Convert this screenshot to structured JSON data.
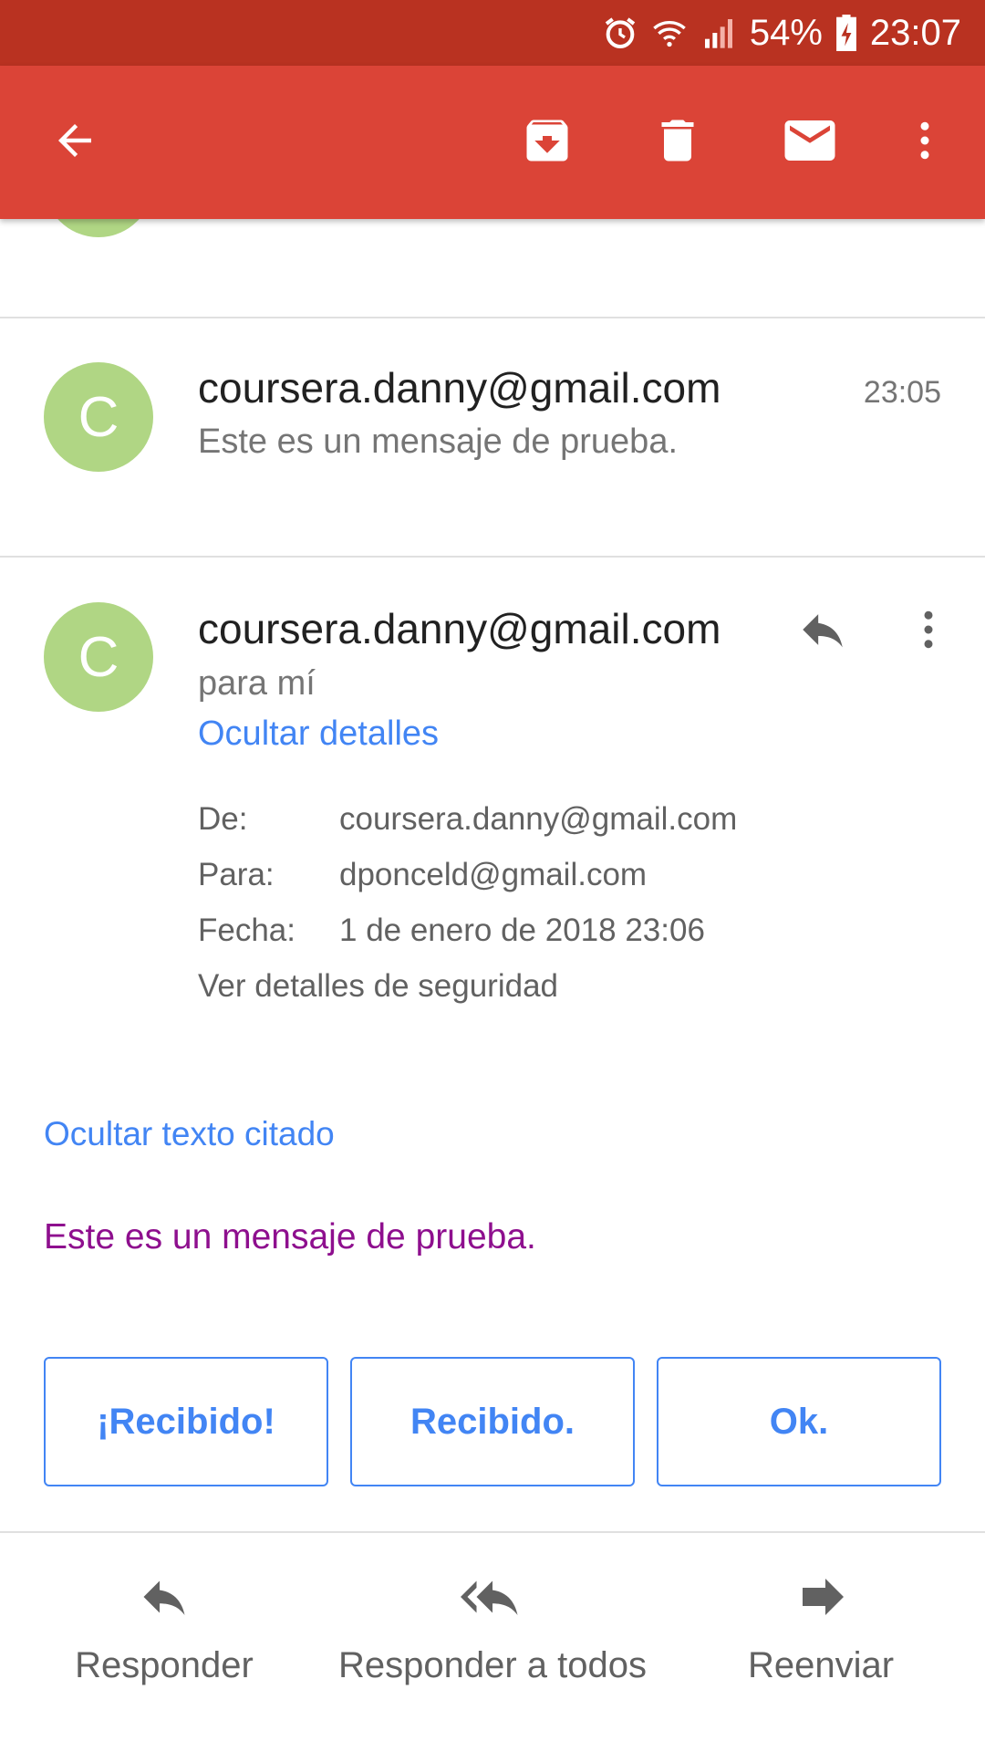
{
  "status_bar": {
    "battery": "54%",
    "time": "23:07",
    "icons": [
      "alarm-icon",
      "wifi-icon",
      "signal-icon",
      "battery-charging-icon"
    ]
  },
  "toolbar": {
    "icons": [
      "back-arrow-icon",
      "archive-icon",
      "delete-icon",
      "mark-unread-icon",
      "more-vert-icon"
    ]
  },
  "messages": [
    {
      "avatar_letter": "C",
      "sender": "coursera.danny@gmail.com",
      "snippet": "Este es un mensaje de prueba.",
      "time": "23:05"
    },
    {
      "avatar_letter": "C",
      "sender": "coursera.danny@gmail.com",
      "recipient_line": "para mí",
      "hide_details": "Ocultar detalles",
      "details": {
        "from_label": "De:",
        "from_value": "coursera.danny@gmail.com",
        "to_label": "Para:",
        "to_value": "dponceld@gmail.com",
        "date_label": "Fecha:",
        "date_value": "1 de enero de 2018 23:06",
        "security_link": "Ver detalles de seguridad"
      },
      "hide_quoted": "Ocultar texto citado",
      "body": "Este es un mensaje de prueba."
    }
  ],
  "smart_replies": [
    "¡Recibido!",
    "Recibido.",
    "Ok."
  ],
  "actions": {
    "reply": "Responder",
    "reply_all": "Responder a todos",
    "forward": "Reenviar"
  },
  "colors": {
    "status_bar": "#b93221",
    "app_bar": "#db4437",
    "avatar": "#b0d684",
    "link": "#4285f4",
    "body_text": "#8e0f8e"
  }
}
